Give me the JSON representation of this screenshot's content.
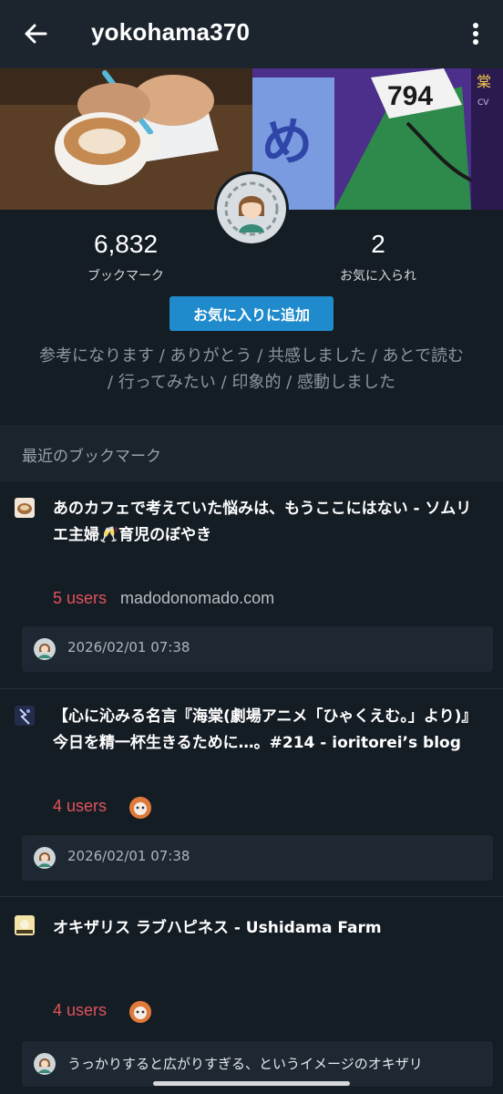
{
  "appbar": {
    "title": "yokohama370",
    "back_icon": "arrow-left-icon",
    "menu_icon": "more-vertical-icon"
  },
  "profile": {
    "bookmarks_count": "6,832",
    "bookmarks_label": "ブックマーク",
    "favorited_count": "2",
    "favorited_label": "お気に入られ",
    "add_favorite_label": "お気に入りに追加",
    "tags": "参考になります / ありがとう / 共感しました / あとで読む / 行ってみたい / 印象的 / 感動しました"
  },
  "section": {
    "title": "最近のブックマーク"
  },
  "bookmarks": [
    {
      "title": "あのカフェで考えていた悩みは、もうここにはない - ソムリエ主婦🥂育児のぼやき",
      "users": "5 users",
      "domain": "madodonomado.com",
      "date": "2026/02/01 07:38"
    },
    {
      "title": "【心に沁みる名言『海棠(劇場アニメ「ひゃくえむ。」より)』今日を精一杯生きるために…。#214 - ioritorei’s blog",
      "users": "4 users",
      "date": "2026/02/01 07:38"
    },
    {
      "title": "オキザリス ラブハピネス - Ushidama Farm",
      "users": "4 users",
      "comment": "うっかりすると広がりすぎる、というイメージのオキザリ"
    }
  ],
  "colors": {
    "background": "#141c24",
    "appbar": "#1c252e",
    "accent": "#1f8bcd",
    "users": "#e0535d"
  }
}
